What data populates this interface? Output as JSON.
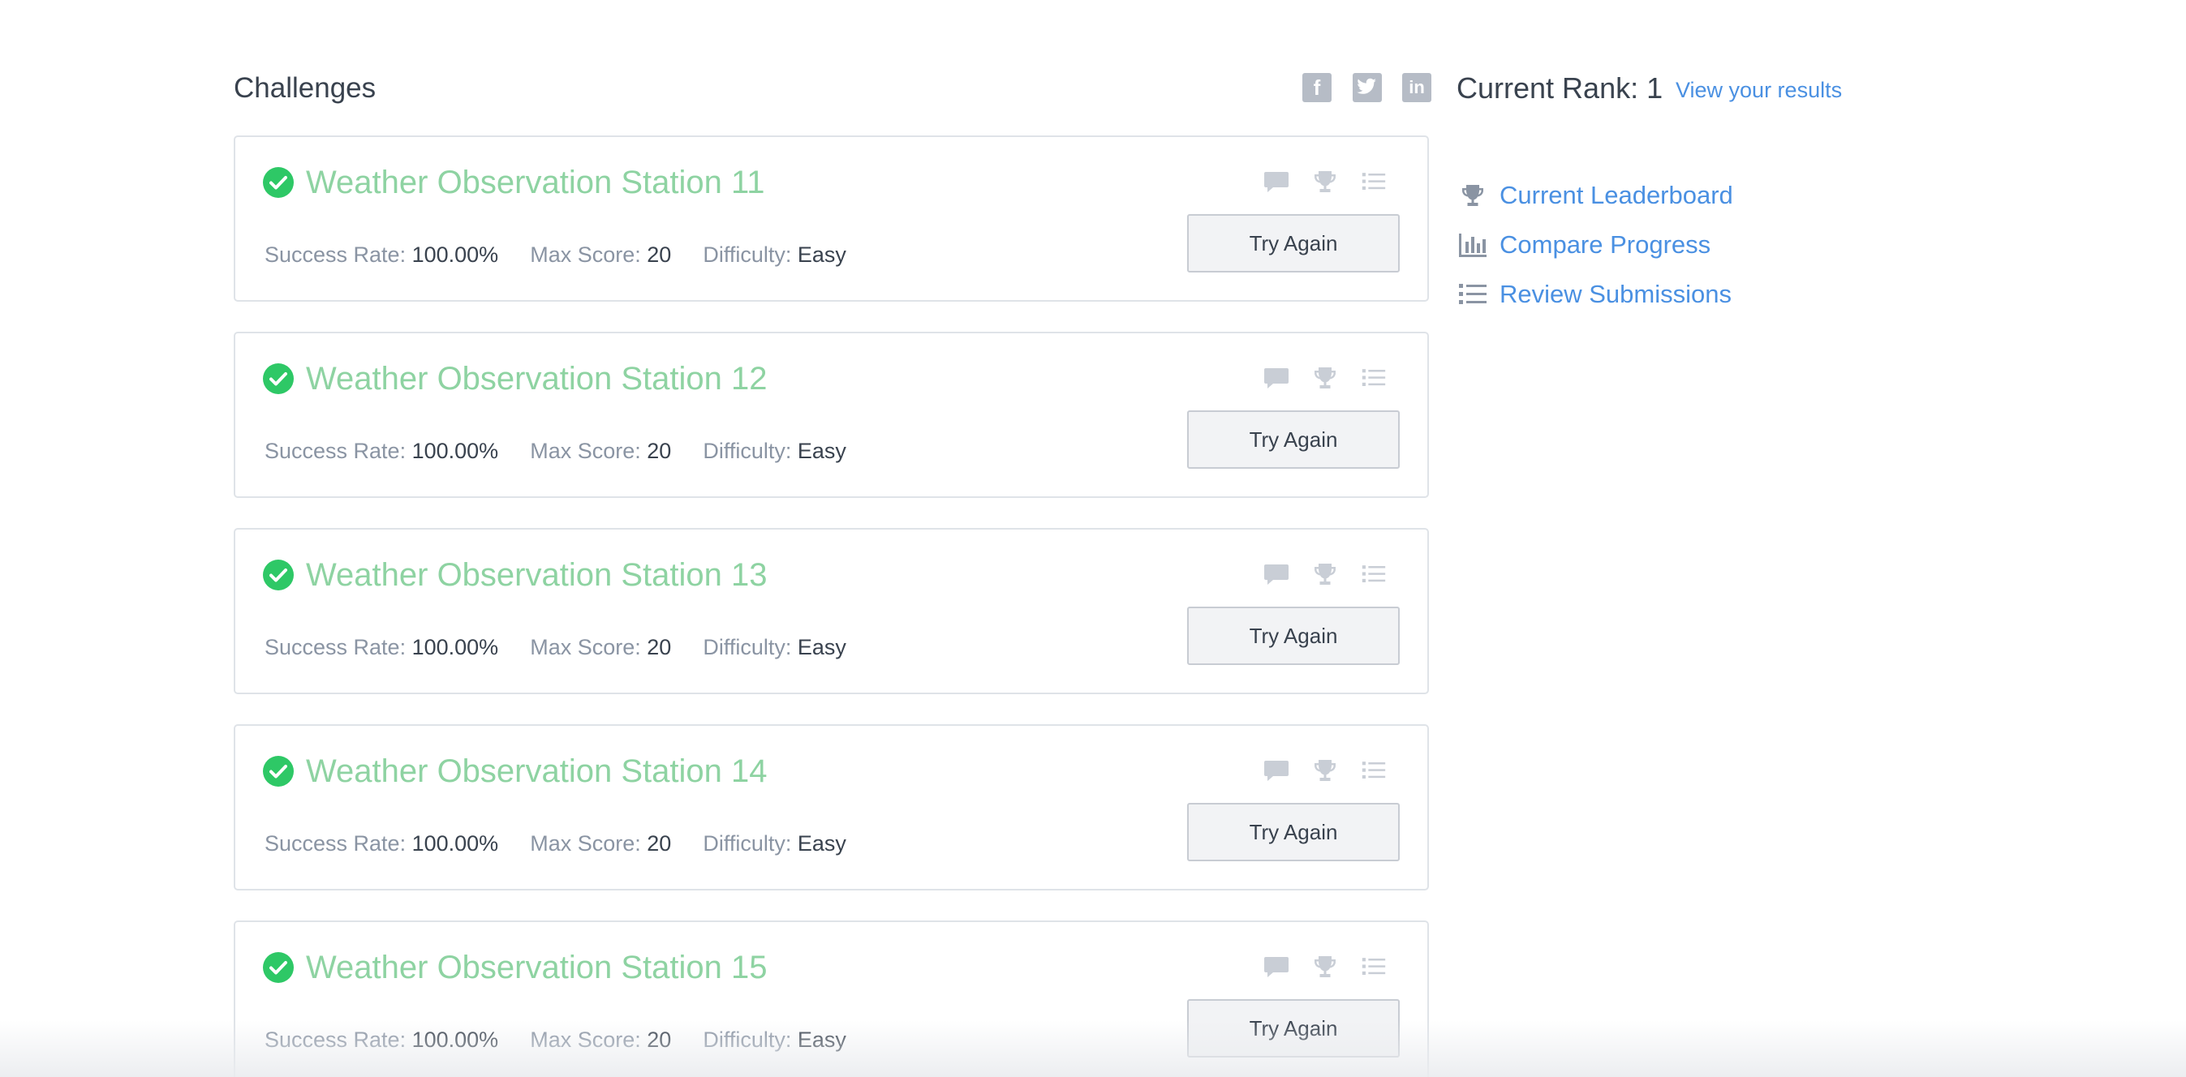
{
  "header": {
    "title": "Challenges",
    "rank_label": "Current Rank:",
    "rank_value": "1",
    "results_link": "View your results"
  },
  "social": [
    {
      "name": "facebook-icon",
      "glyph": "f"
    },
    {
      "name": "twitter-icon",
      "glyph": ""
    },
    {
      "name": "linkedin-icon",
      "glyph": "in"
    }
  ],
  "sidebar": {
    "items": [
      {
        "label": "Current Leaderboard",
        "icon": "trophy-icon"
      },
      {
        "label": "Compare Progress",
        "icon": "bar-chart-icon"
      },
      {
        "label": "Review Submissions",
        "icon": "list-icon"
      }
    ]
  },
  "challenge_labels": {
    "success_rate": "Success Rate:",
    "max_score": "Max Score:",
    "difficulty": "Difficulty:",
    "try_again": "Try Again"
  },
  "challenges": [
    {
      "title": "Weather Observation Station 11",
      "success_rate": "100.00%",
      "max_score": "20",
      "difficulty": "Easy",
      "status": "solved"
    },
    {
      "title": "Weather Observation Station 12",
      "success_rate": "100.00%",
      "max_score": "20",
      "difficulty": "Easy",
      "status": "solved"
    },
    {
      "title": "Weather Observation Station 13",
      "success_rate": "100.00%",
      "max_score": "20",
      "difficulty": "Easy",
      "status": "solved"
    },
    {
      "title": "Weather Observation Station 14",
      "success_rate": "100.00%",
      "max_score": "20",
      "difficulty": "Easy",
      "status": "solved"
    },
    {
      "title": "Weather Observation Station 15",
      "success_rate": "100.00%",
      "max_score": "20",
      "difficulty": "Easy",
      "status": "solved"
    }
  ],
  "colors": {
    "accent_link": "#4a90e2",
    "solved_green": "#2ec866",
    "title_green": "#8ed3a2",
    "icon_gray": "#c9ced6"
  }
}
